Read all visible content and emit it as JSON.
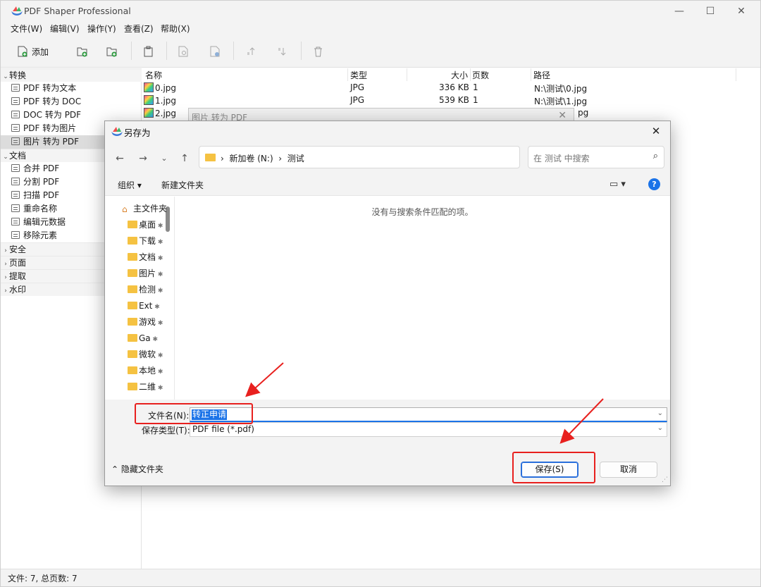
{
  "app": {
    "title": "PDF Shaper Professional"
  },
  "menu": [
    "文件(W)",
    "编辑(V)",
    "操作(Y)",
    "查看(Z)",
    "帮助(X)"
  ],
  "toolbar": {
    "add_label": "添加"
  },
  "tree": [
    {
      "label": "转换",
      "type": "cat",
      "chev": "⌄"
    },
    {
      "label": "PDF 转为文本",
      "type": "item"
    },
    {
      "label": "PDF 转为 DOC",
      "type": "item"
    },
    {
      "label": "DOC 转为 PDF",
      "type": "item"
    },
    {
      "label": "PDF 转为图片",
      "type": "item"
    },
    {
      "label": "图片 转为 PDF",
      "type": "item",
      "selected": true
    },
    {
      "label": "文档",
      "type": "cat",
      "chev": "⌄"
    },
    {
      "label": "合并 PDF",
      "type": "item"
    },
    {
      "label": "分割 PDF",
      "type": "item"
    },
    {
      "label": "扫描 PDF",
      "type": "item"
    },
    {
      "label": "重命名称",
      "type": "item"
    },
    {
      "label": "编辑元数据",
      "type": "item"
    },
    {
      "label": "移除元素",
      "type": "item"
    },
    {
      "label": "安全",
      "type": "cat",
      "chev": "›"
    },
    {
      "label": "页面",
      "type": "cat",
      "chev": "›"
    },
    {
      "label": "提取",
      "type": "cat",
      "chev": "›"
    },
    {
      "label": "水印",
      "type": "cat",
      "chev": "›"
    }
  ],
  "filelist": {
    "headers": {
      "name": "名称",
      "type": "类型",
      "size": "大小",
      "pages": "页数",
      "path": "路径"
    },
    "rows": [
      {
        "name": "0.jpg",
        "type": "JPG",
        "size": "336 KB",
        "pages": "1",
        "path": "N:\\测试\\0.jpg"
      },
      {
        "name": "1.jpg",
        "type": "JPG",
        "size": "539 KB",
        "pages": "1",
        "path": "N:\\测试\\1.jpg"
      },
      {
        "name": "2.jpg",
        "type": "",
        "size": "",
        "pages": "",
        "path": "pg"
      }
    ]
  },
  "bg_dialog": {
    "title": "图片 转为 PDF"
  },
  "status": {
    "text": "文件: 7, 总页数: 7"
  },
  "save_dialog": {
    "title": "另存为",
    "address": [
      "新加卷 (N:)",
      "测试"
    ],
    "search_placeholder": "在 测试 中搜索",
    "organize": "组织 ▾",
    "new_folder": "新建文件夹",
    "nav_items": [
      "主文件夹",
      "桌面",
      "下载",
      "文档",
      "图片",
      "检测",
      "Ext",
      "游戏",
      "Ga",
      "微软",
      "本地",
      "二维"
    ],
    "empty_message": "没有与搜索条件匹配的项。",
    "filename_label": "文件名(N):",
    "filename_value": "转正申请",
    "filetype_label": "保存类型(T):",
    "filetype_value": "PDF file (*.pdf)",
    "hide_folders": "隐藏文件夹",
    "save_button": "保存(S)",
    "cancel_button": "取消"
  },
  "colors": {
    "accent": "#1b73e8",
    "annotation": "#e8201e"
  }
}
